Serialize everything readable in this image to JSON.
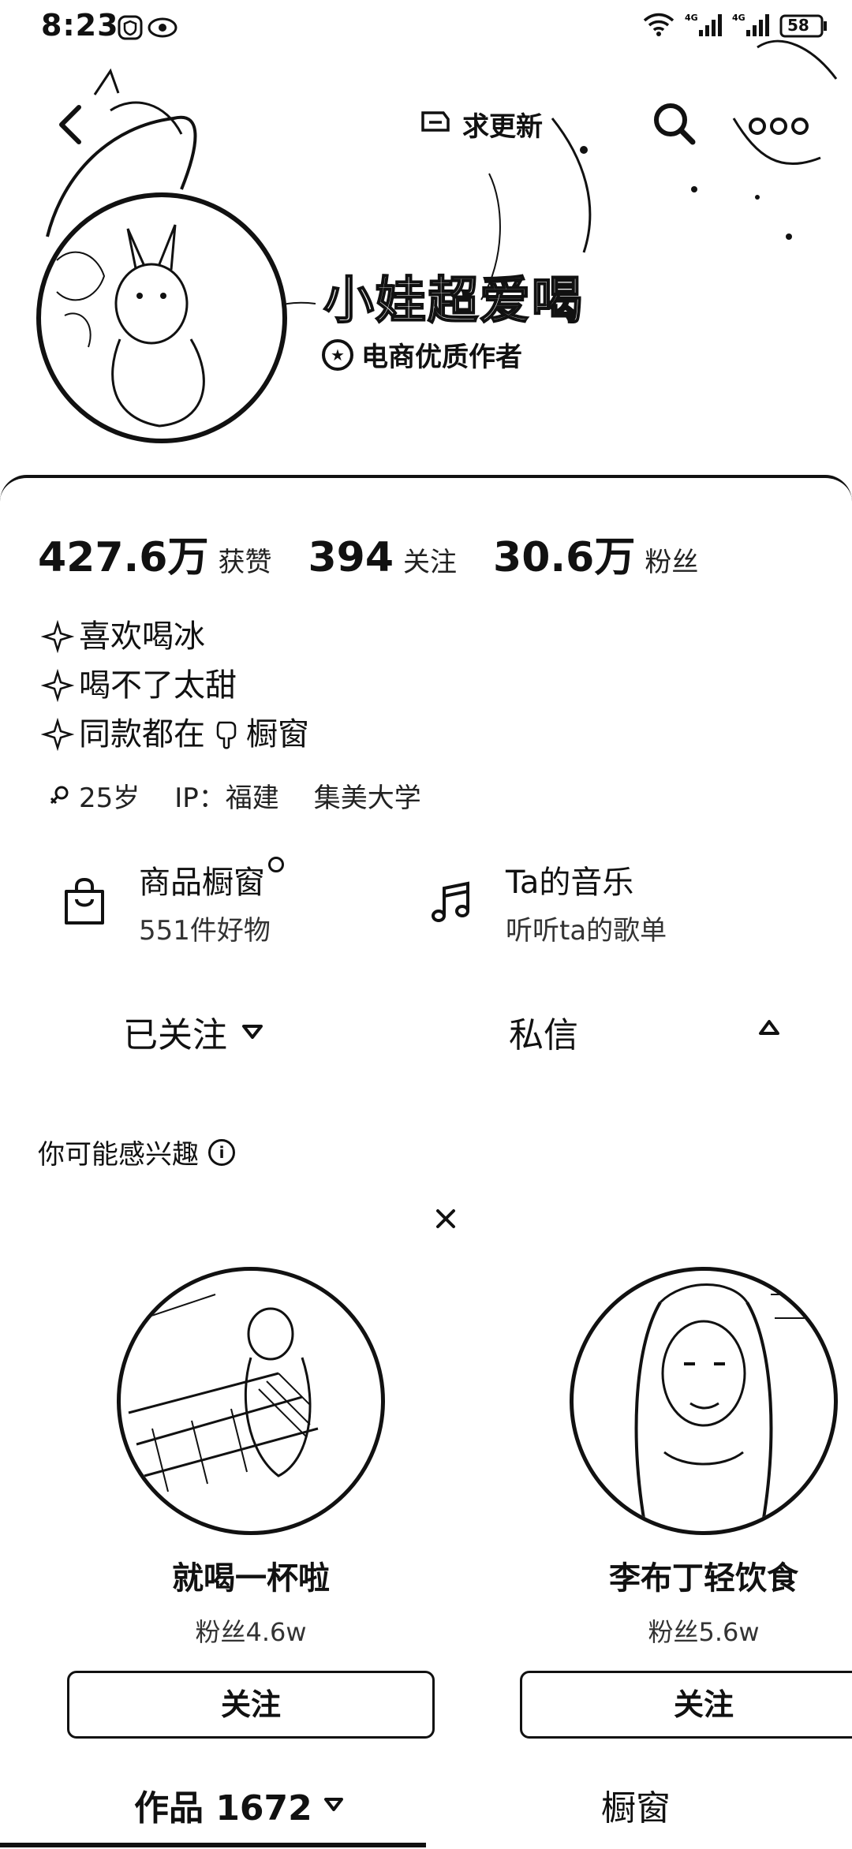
{
  "status_bar": {
    "time": "8:23",
    "battery": "58"
  },
  "topbar": {
    "refresh_label": "求更新"
  },
  "profile": {
    "nickname": "小娃超爱喝",
    "badge": "电商优质作者"
  },
  "stats": [
    {
      "value": "427.6万",
      "label": "获赞"
    },
    {
      "value": "394",
      "label": "关注"
    },
    {
      "value": "30.6万",
      "label": "粉丝"
    }
  ],
  "bio": {
    "lines": [
      "喜欢喝冰",
      "喝不了太甜",
      "同款都在",
      "橱窗"
    ],
    "age": "25岁",
    "ip": "IP：福建",
    "school": "集美大学"
  },
  "cards": {
    "shop": {
      "title": "商品橱窗",
      "subtitle": "551件好物"
    },
    "music": {
      "title": "Ta的音乐",
      "subtitle": "听听ta的歌单"
    }
  },
  "actions": {
    "followed_label": "已关注",
    "message_label": "私信"
  },
  "recommend": {
    "title": "你可能感兴趣",
    "users": [
      {
        "name": "就喝一杯啦",
        "fans": "粉丝4.6w",
        "button": "关注"
      },
      {
        "name": "李布丁轻饮食",
        "fans": "粉丝5.6w",
        "button": "关注"
      }
    ]
  },
  "tabs": {
    "works_label": "作品 1672",
    "shop_label": "橱窗"
  },
  "icons": {
    "back": "chevron-left-icon",
    "search": "search-icon",
    "more": "more-icon",
    "shop": "shopping-bag-icon",
    "music": "music-note-icon"
  }
}
